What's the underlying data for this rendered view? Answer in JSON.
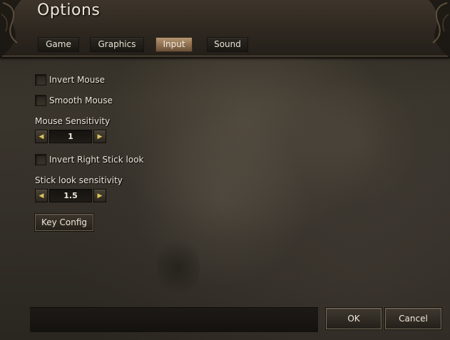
{
  "window": {
    "title": "Options"
  },
  "tabs": [
    {
      "label": "Game",
      "active": false
    },
    {
      "label": "Graphics",
      "active": false
    },
    {
      "label": "Input",
      "active": true
    },
    {
      "label": "Sound",
      "active": false
    }
  ],
  "input": {
    "invert_mouse": {
      "label": "Invert Mouse",
      "checked": false
    },
    "smooth_mouse": {
      "label": "Smooth Mouse",
      "checked": false
    },
    "mouse_sensitivity": {
      "label": "Mouse Sensitivity",
      "value": "1"
    },
    "invert_right_stick": {
      "label": "Invert Right Stick look",
      "checked": false
    },
    "stick_sensitivity": {
      "label": "Stick look sensitivity",
      "value": "1.5"
    },
    "key_config_label": "Key Config"
  },
  "footer": {
    "ok_label": "OK",
    "cancel_label": "Cancel"
  },
  "icons": {
    "decrease": "arrow-left-icon",
    "increase": "arrow-right-icon"
  },
  "colors": {
    "text": "#ece6da",
    "active_tab": "#b59672",
    "arrow": "#d8c35a"
  }
}
